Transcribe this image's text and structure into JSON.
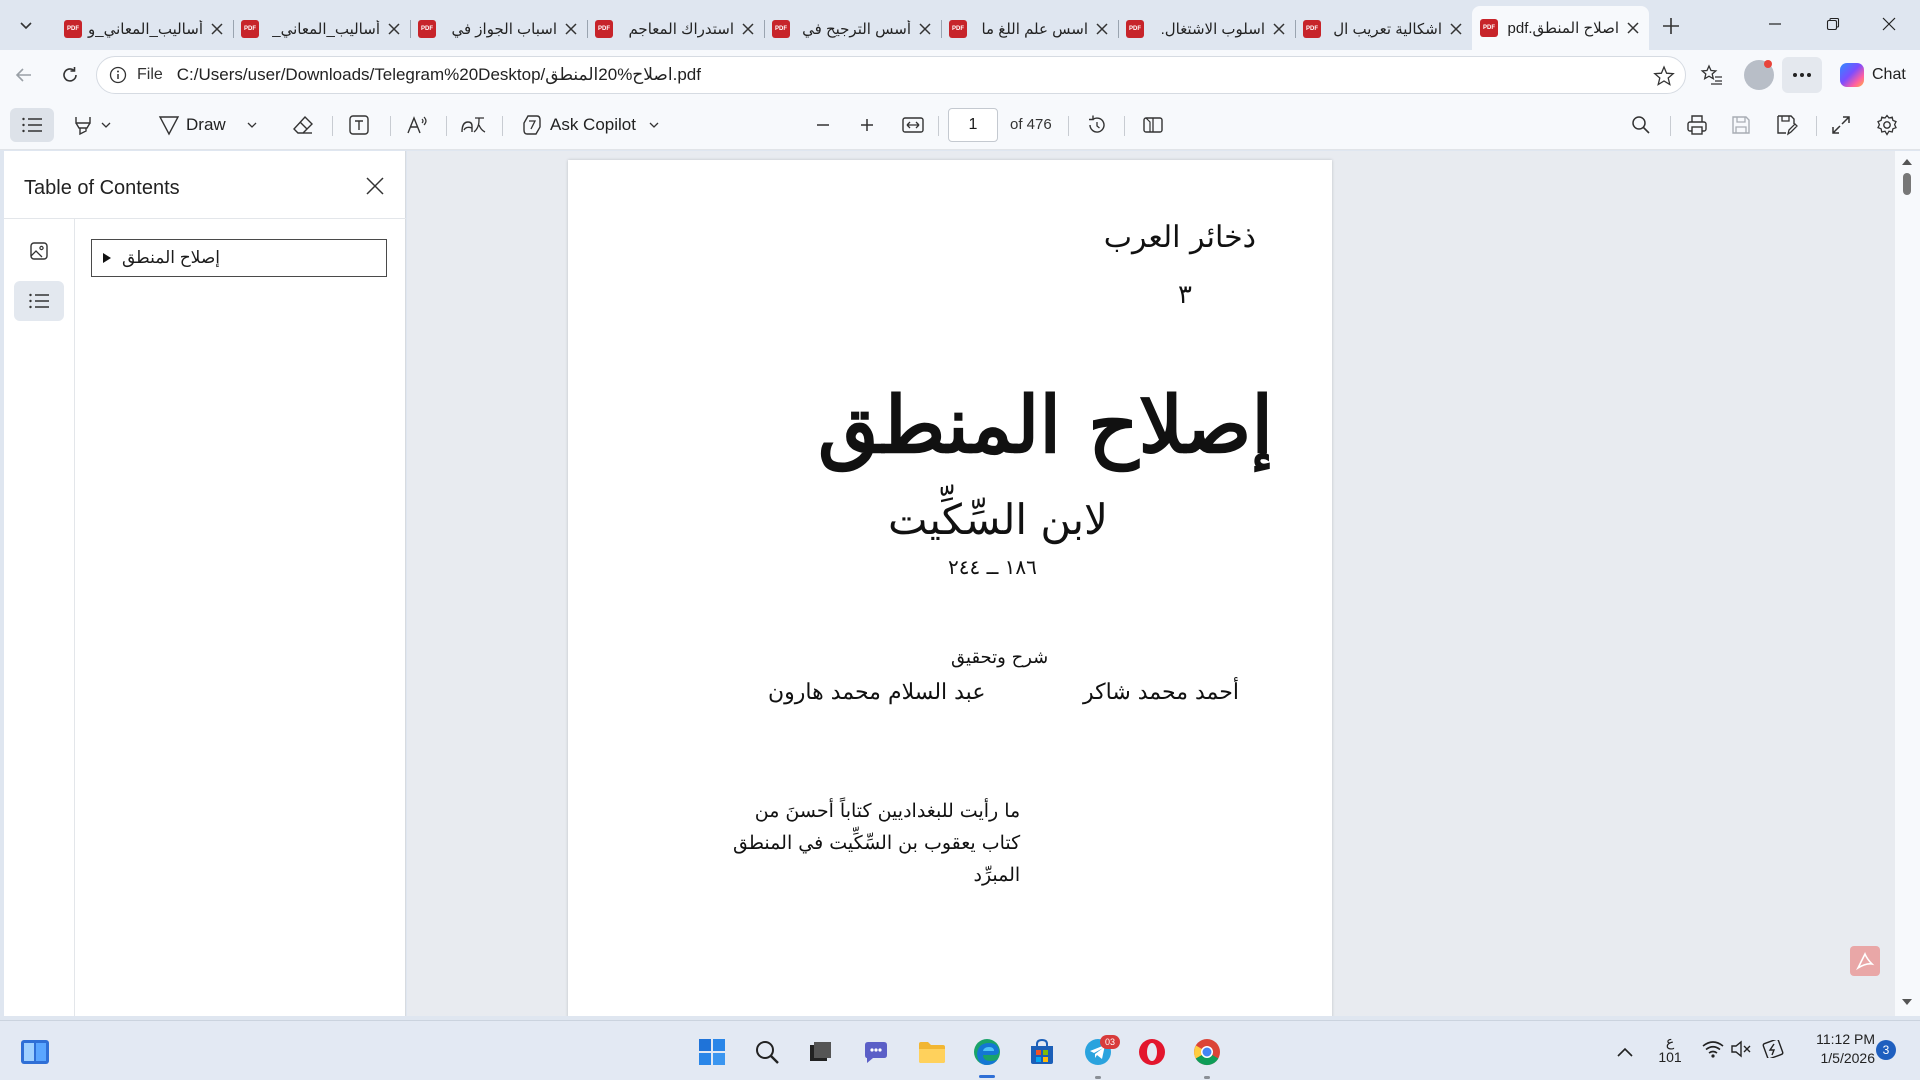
{
  "browser": {
    "tabs": [
      {
        "title": "أساليب_المعاني_و",
        "active": false
      },
      {
        "title": "أساليب_المعاني_",
        "active": false
      },
      {
        "title": "اسباب الجواز في",
        "active": false
      },
      {
        "title": "استدراك المعاجم",
        "active": false
      },
      {
        "title": "أسس الترجيح في",
        "active": false
      },
      {
        "title": "اسس علم اللغ ما",
        "active": false
      },
      {
        "title": "اسلوب الاشتغال.",
        "active": false
      },
      {
        "title": "اشكالية تعريب ال",
        "active": false
      },
      {
        "title": "اصلاح المنطق.pdf",
        "active": true
      }
    ],
    "pdf_badge": "PDF",
    "address": {
      "scheme_label": "File",
      "url": "C:/Users/user/Downloads/Telegram%20Desktop/اصلاح%20المنطق.pdf"
    },
    "chat_label": "Chat"
  },
  "pdf_toolbar": {
    "draw_label": "Draw",
    "copilot_label": "Ask Copilot",
    "page_current": "1",
    "page_total": "of 476"
  },
  "sidebar": {
    "title": "Table of Contents",
    "toc": [
      {
        "label": "إصلاح المنطق"
      }
    ]
  },
  "document": {
    "series": "ذخائر العرب",
    "series_number": "٣",
    "title": "إصلاح المنطق",
    "author": "لابن السِّكِّيت",
    "dates": "١٨٦ ــ ٢٤٤",
    "commentary_label": "شرح وتحقيق",
    "editor1": "أحمد محمد شاكر",
    "editor2": "عبد السلام محمد هارون",
    "quote_line1": "ما رأيت للبغداديين كتاباً أحسنَ من",
    "quote_line2": "كتاب يعقوب بن السِّكِّيت في المنطق",
    "quote_attribution": "المبرِّد"
  },
  "taskbar": {
    "telegram_badge": "03",
    "lang_top": "ع",
    "lang_bottom": "101",
    "time": "11:12 PM",
    "date": "1/5/2026",
    "notification_count": "3"
  },
  "colors": {
    "accent": "#2f6fd6",
    "pdf_red": "#c7242a",
    "chrome_bg": "#dfe6f0",
    "toolbar_bg": "#f7f9fc"
  }
}
